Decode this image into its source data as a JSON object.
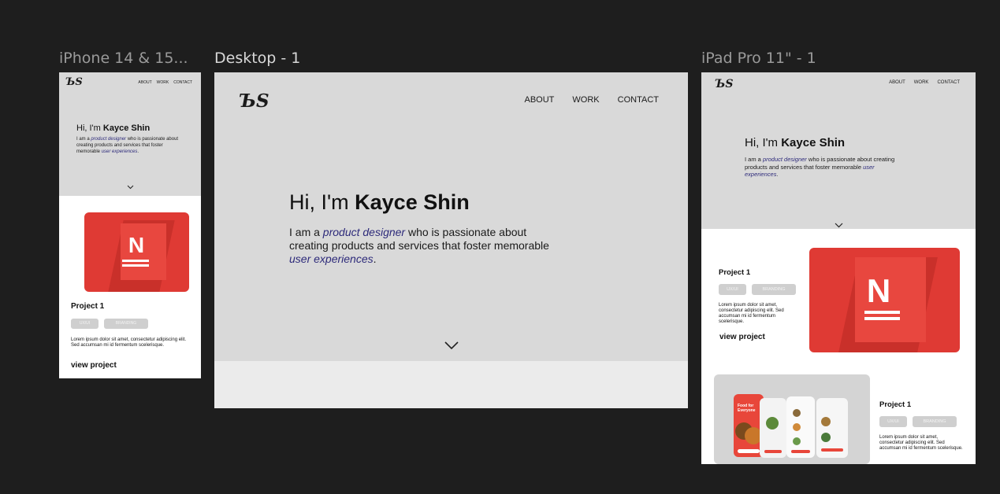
{
  "frames": {
    "iphone_label": "iPhone 14 & 15...",
    "desktop_label": "Desktop - 1",
    "ipad_label": "iPad Pro 11\" - 1"
  },
  "site": {
    "logo": "ЪЅ",
    "nav": {
      "about": "ABOUT",
      "work": "WORK",
      "contact": "CONTACT"
    },
    "greeting": "Hi, I'm ",
    "name": "Kayce Shin",
    "intro": {
      "p1": "I am a ",
      "role": "product designer",
      "p2": " who is passionate about creating products and services that foster memorable ",
      "goal": "user experiences",
      "p3": "."
    },
    "project": {
      "title": "Project 1",
      "tags": [
        "UX/UI",
        "BRANDING"
      ],
      "lorem_mobile": "Lorem ipsum dolor sit amet, consectetur adipiscing elit. Sed accumsan mi id fermentum scelerisque.",
      "lorem_tablet": "Lorem ipsum dolor sit amet, consectetur adipiscing elit. Sed accumsan mi id fermentum scelerisque.",
      "view": "view project",
      "thumb_letter": "N"
    },
    "food_card": {
      "headline": "Food for Everyone"
    }
  },
  "colors": {
    "canvas": "#1e1e1e",
    "hero_bg": "#d9d9d9",
    "accent_red": "#df3a34",
    "italic_link": "#2d2a7a"
  }
}
